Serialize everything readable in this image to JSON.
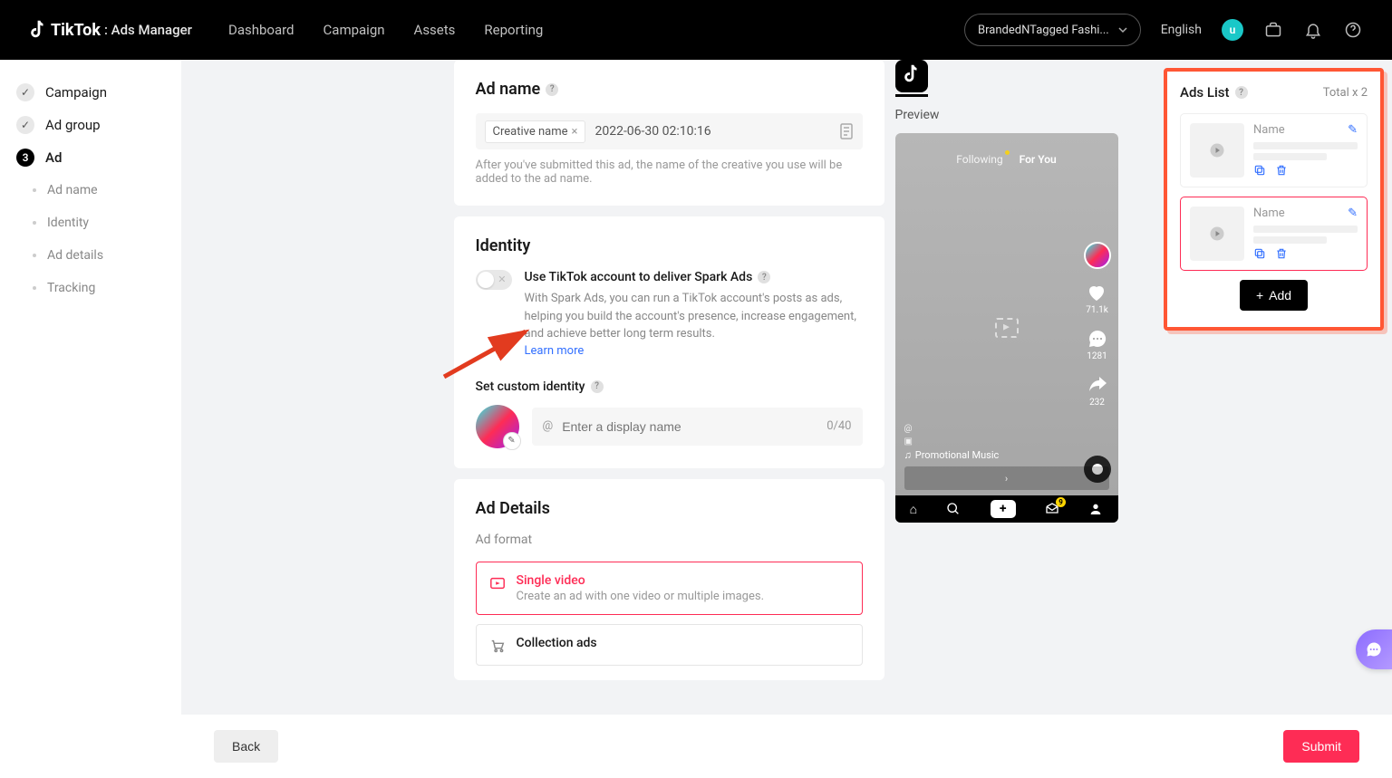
{
  "header": {
    "brand": "TikTok",
    "brand_sub": ": Ads Manager",
    "nav": [
      "Dashboard",
      "Campaign",
      "Assets",
      "Reporting"
    ],
    "account": "BrandedNTagged Fashi...",
    "language": "English",
    "avatar_letter": "u"
  },
  "sidebar": {
    "steps": [
      {
        "label": "Campaign",
        "state": "done"
      },
      {
        "label": "Ad group",
        "state": "done"
      },
      {
        "label": "Ad",
        "state": "active",
        "num": "3"
      }
    ],
    "substeps": [
      "Ad name",
      "Identity",
      "Ad details",
      "Tracking"
    ]
  },
  "ad_name": {
    "title": "Ad name",
    "chip": "Creative name",
    "value": "2022-06-30 02:10:16",
    "note": "After you've submitted this ad, the name of the creative you use will be added to the ad name."
  },
  "identity": {
    "title": "Identity",
    "toggle_label": "Use TikTok account to deliver Spark Ads",
    "toggle_desc": "With Spark Ads, you can run a TikTok account's posts as ads, helping you build the account's presence, increase engagement, and achieve better long term results.",
    "learn_more": "Learn more",
    "custom_title": "Set custom identity",
    "placeholder": "Enter a display name",
    "counter": "0/40"
  },
  "ad_details": {
    "title": "Ad Details",
    "format_label": "Ad format",
    "formats": [
      {
        "title": "Single video",
        "desc": "Create an ad with one video or multiple images.",
        "selected": true
      },
      {
        "title": "Collection ads",
        "desc": "",
        "selected": false
      }
    ]
  },
  "preview": {
    "label": "Preview",
    "following": "Following",
    "foryou": "For You",
    "likes": "71.1k",
    "comments": "1281",
    "shares": "232",
    "music": "Promotional Music"
  },
  "ads_list": {
    "title": "Ads List",
    "total": "Total x 2",
    "items": [
      {
        "name": "Name",
        "selected": false
      },
      {
        "name": "Name",
        "selected": true
      }
    ],
    "add_label": "Add"
  },
  "footer": {
    "back": "Back",
    "submit": "Submit"
  }
}
